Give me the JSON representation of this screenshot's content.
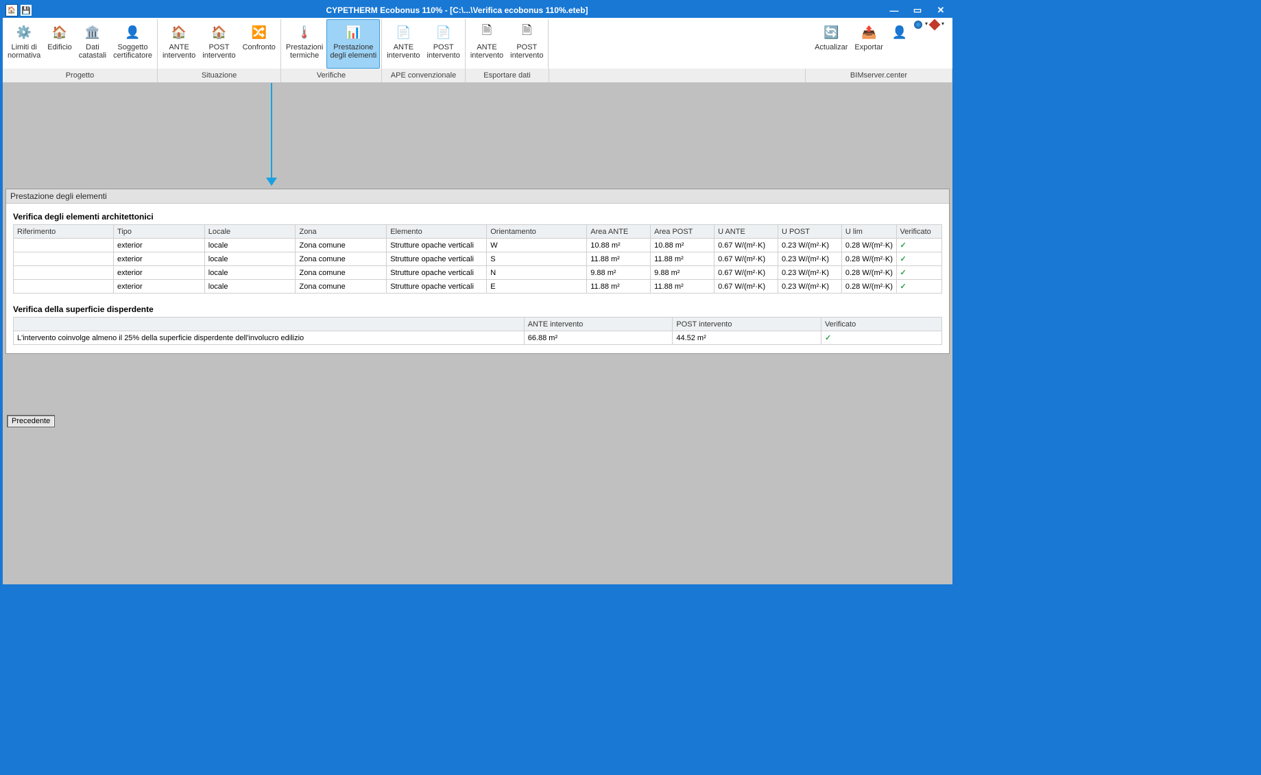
{
  "titlebar": {
    "title": "CYPETHERM Ecobonus 110% - [C:\\...\\Verifica ecobonus 110%.eteb]"
  },
  "ribbon": {
    "groups": [
      {
        "key": "progetto",
        "label": "Progetto",
        "buttons": [
          {
            "id": "limiti-normativa",
            "l1": "Limiti di",
            "l2": "normativa",
            "icon": "⚙️"
          },
          {
            "id": "edificio",
            "l1": "Edificio",
            "l2": "",
            "icon": "🏠"
          },
          {
            "id": "dati-catastali",
            "l1": "Dati",
            "l2": "catastali",
            "icon": "🏛️"
          },
          {
            "id": "soggetto-certificatore",
            "l1": "Soggetto",
            "l2": "certificatore",
            "icon": "👤"
          }
        ]
      },
      {
        "key": "situazione",
        "label": "Situazione",
        "buttons": [
          {
            "id": "ante-intervento-sit",
            "l1": "ANTE",
            "l2": "intervento",
            "icon": "🏠"
          },
          {
            "id": "post-intervento-sit",
            "l1": "POST",
            "l2": "intervento",
            "icon": "🏠"
          },
          {
            "id": "confronto",
            "l1": "Confronto",
            "l2": "",
            "icon": "🔀"
          }
        ]
      },
      {
        "key": "verifiche",
        "label": "Verifiche",
        "buttons": [
          {
            "id": "prestazioni-termiche",
            "l1": "Prestazioni",
            "l2": "termiche",
            "icon": "🌡️"
          },
          {
            "id": "prestazione-elementi",
            "l1": "Prestazione",
            "l2": "degli elementi",
            "icon": "📊",
            "active": true
          }
        ]
      },
      {
        "key": "ape",
        "label": "APE convenzionale",
        "buttons": [
          {
            "id": "ante-intervento-ape",
            "l1": "ANTE",
            "l2": "intervento",
            "icon": "📄"
          },
          {
            "id": "post-intervento-ape",
            "l1": "POST",
            "l2": "intervento",
            "icon": "📄"
          }
        ]
      },
      {
        "key": "esportare",
        "label": "Esportare dati",
        "buttons": [
          {
            "id": "ante-intervento-exp",
            "l1": "ANTE",
            "l2": "intervento",
            "icon": "🗎"
          },
          {
            "id": "post-intervento-exp",
            "l1": "POST",
            "l2": "intervento",
            "icon": "🗎"
          }
        ]
      }
    ],
    "right": {
      "actualizar": "Actualizar",
      "exportar": "Exportar"
    },
    "rightTab": "BIMserver.center"
  },
  "panel": {
    "header": "Prestazione degli elementi",
    "section1": {
      "title": "Verifica degli elementi architettonici",
      "headers": [
        "Riferimento",
        "Tipo",
        "Locale",
        "Zona",
        "Elemento",
        "Orientamento",
        "Area ANTE",
        "Area POST",
        "U ANTE",
        "U POST",
        "U lim",
        "Verificato"
      ],
      "rows": [
        {
          "rif": "",
          "tipo": "exterior",
          "locale": "locale",
          "zona": "Zona comune",
          "elemento": "Strutture opache verticali",
          "orient": "W",
          "aante": "10.88 m²",
          "apost": "10.88 m²",
          "uante": "0.67 W/(m²·K)",
          "upost": "0.23 W/(m²·K)",
          "ulim": "0.28 W/(m²·K)",
          "ver": "✓"
        },
        {
          "rif": "",
          "tipo": "exterior",
          "locale": "locale",
          "zona": "Zona comune",
          "elemento": "Strutture opache verticali",
          "orient": "S",
          "aante": "11.88 m²",
          "apost": "11.88 m²",
          "uante": "0.67 W/(m²·K)",
          "upost": "0.23 W/(m²·K)",
          "ulim": "0.28 W/(m²·K)",
          "ver": "✓"
        },
        {
          "rif": "",
          "tipo": "exterior",
          "locale": "locale",
          "zona": "Zona comune",
          "elemento": "Strutture opache verticali",
          "orient": "N",
          "aante": "9.88 m²",
          "apost": "9.88 m²",
          "uante": "0.67 W/(m²·K)",
          "upost": "0.23 W/(m²·K)",
          "ulim": "0.28 W/(m²·K)",
          "ver": "✓"
        },
        {
          "rif": "",
          "tipo": "exterior",
          "locale": "locale",
          "zona": "Zona comune",
          "elemento": "Strutture opache verticali",
          "orient": "E",
          "aante": "11.88 m²",
          "apost": "11.88 m²",
          "uante": "0.67 W/(m²·K)",
          "upost": "0.23 W/(m²·K)",
          "ulim": "0.28 W/(m²·K)",
          "ver": "✓"
        }
      ]
    },
    "section2": {
      "title": "Verifica della superficie disperdente",
      "headers": [
        "",
        "ANTE intervento",
        "POST intervento",
        "Verificato"
      ],
      "row": {
        "desc": "L'intervento coinvolge almeno il 25% della superficie disperdente dell'involucro edilizio",
        "ante": "66.88 m²",
        "post": "44.52 m²",
        "ver": "✓"
      }
    }
  },
  "precedente": "Precedente"
}
